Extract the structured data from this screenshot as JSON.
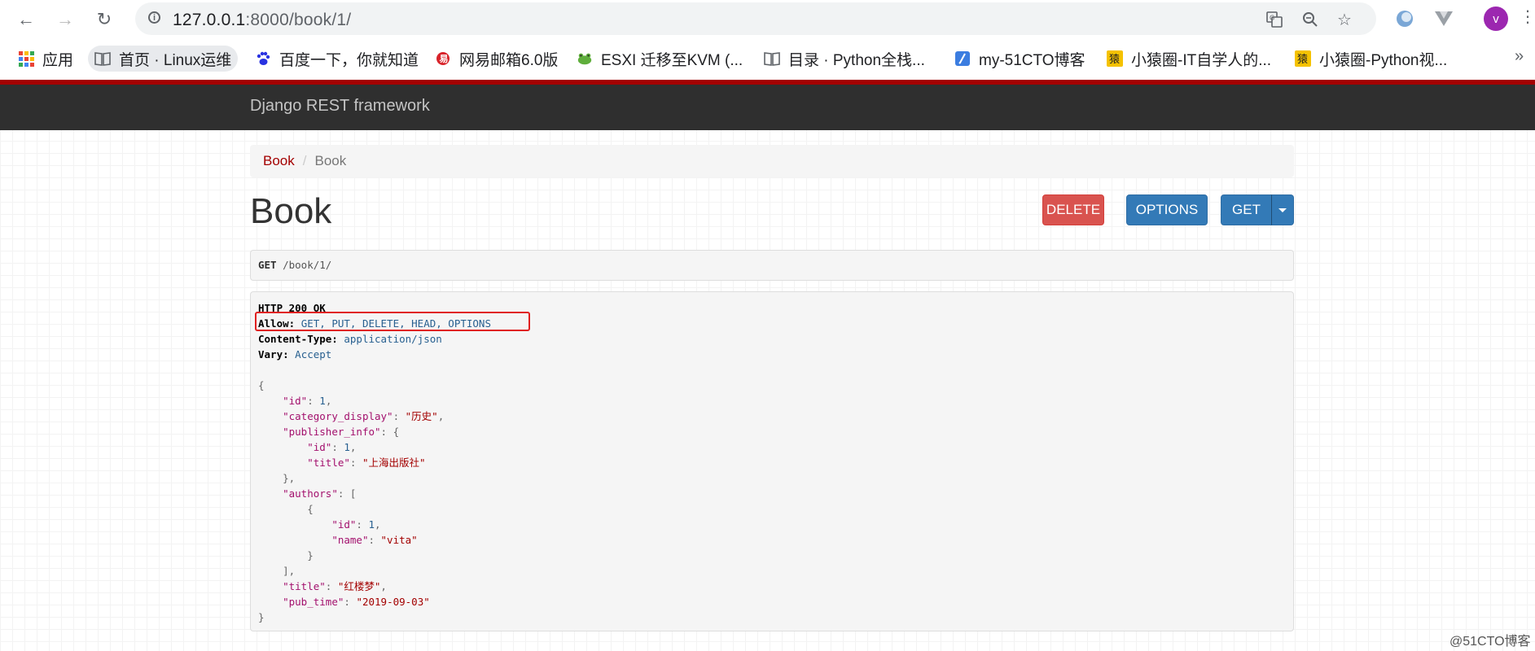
{
  "browser": {
    "url_host": "127.0.0.1",
    "url_rest": ":8000/book/1/",
    "avatar_letter": "v",
    "bookmarks": [
      {
        "label": "应用",
        "icon": "apps-grid-icon"
      },
      {
        "label": "首页 · Linux运维",
        "icon": "book-icon"
      },
      {
        "label": "百度一下，你就知道",
        "icon": "baidu-paw-icon"
      },
      {
        "label": "网易邮箱6.0版",
        "icon": "netease-icon"
      },
      {
        "label": "ESXI 迁移至KVM (...",
        "icon": "frog-icon"
      },
      {
        "label": "目录 · Python全栈...",
        "icon": "book-icon"
      },
      {
        "label": "my-51CTO博客",
        "icon": "pen-icon"
      },
      {
        "label": "小猿圈-IT自学人的...",
        "icon": "ape-icon"
      },
      {
        "label": "小猿圈-Python视...",
        "icon": "ape-icon"
      }
    ]
  },
  "navbar": {
    "brand": "Django REST framework"
  },
  "breadcrumb": {
    "link": "Book",
    "separator": "/",
    "active": "Book"
  },
  "page": {
    "title": "Book"
  },
  "buttons": {
    "delete": "DELETE",
    "options": "OPTIONS",
    "get": "GET"
  },
  "request": {
    "method": "GET",
    "path": "/book/1/"
  },
  "response": {
    "status": "HTTP 200 OK",
    "headers": [
      {
        "key": "Allow:",
        "value": "GET, PUT, DELETE, HEAD, OPTIONS"
      },
      {
        "key": "Content-Type:",
        "value": "application/json"
      },
      {
        "key": "Vary:",
        "value": "Accept"
      }
    ],
    "body": {
      "id_key": "\"id\"",
      "id": "1",
      "category_key": "\"category_display\"",
      "category": "\"历史\"",
      "publisher_key": "\"publisher_info\"",
      "publisher_id_key": "\"id\"",
      "publisher_id": "1",
      "publisher_title_key": "\"title\"",
      "publisher_title": "\"上海出版社\"",
      "authors_key": "\"authors\"",
      "author_id_key": "\"id\"",
      "author_id": "1",
      "author_name_key": "\"name\"",
      "author_name": "\"vita\"",
      "title_key": "\"title\"",
      "title": "\"红楼梦\"",
      "pub_time_key": "\"pub_time\"",
      "pub_time": "\"2019-09-03\""
    }
  },
  "watermark": "@51CTO博客"
}
